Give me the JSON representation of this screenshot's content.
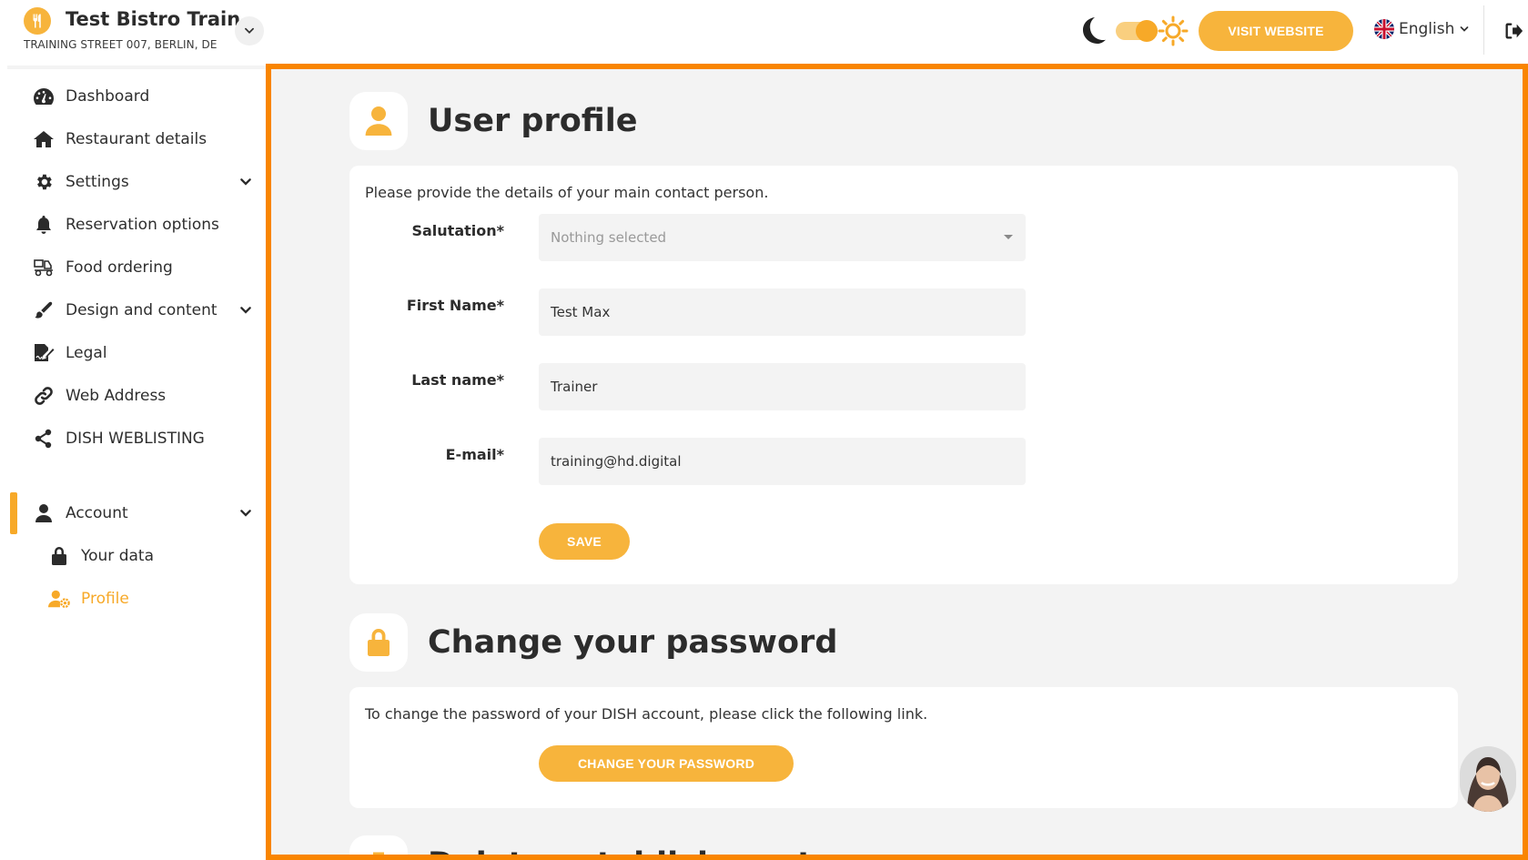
{
  "brand": {
    "name": "Test Bistro Train..",
    "address": "TRAINING STREET 007, BERLIN, DE"
  },
  "topbar": {
    "visit_website": "VISIT WEBSITE",
    "language": "English"
  },
  "sidebar": {
    "items": [
      {
        "label": "Dashboard"
      },
      {
        "label": "Restaurant details"
      },
      {
        "label": "Settings"
      },
      {
        "label": "Reservation options"
      },
      {
        "label": "Food ordering"
      },
      {
        "label": "Design and content"
      },
      {
        "label": "Legal"
      },
      {
        "label": "Web Address"
      },
      {
        "label": "DISH WEBLISTING"
      },
      {
        "label": "Account"
      },
      {
        "label": "Your data"
      },
      {
        "label": "Profile"
      }
    ]
  },
  "profile": {
    "title": "User profile",
    "intro": "Please provide the details of your main contact person.",
    "salutation_label": "Salutation*",
    "salutation_value": "Nothing selected",
    "first_name_label": "First Name*",
    "first_name_value": "Test Max",
    "last_name_label": "Last name*",
    "last_name_value": "Trainer",
    "email_label": "E-mail*",
    "email_value": "training@hd.digital",
    "save_label": "SAVE"
  },
  "password": {
    "title": "Change your password",
    "intro": "To change the password of your DISH account, please click the following link.",
    "button_label": "CHANGE YOUR PASSWORD"
  },
  "delete": {
    "title": "Delete establishment"
  },
  "colors": {
    "accent": "#f7b43c",
    "accent_dark": "#f7a928",
    "highlight_border": "#f98500",
    "background": "#f3f3f3"
  }
}
